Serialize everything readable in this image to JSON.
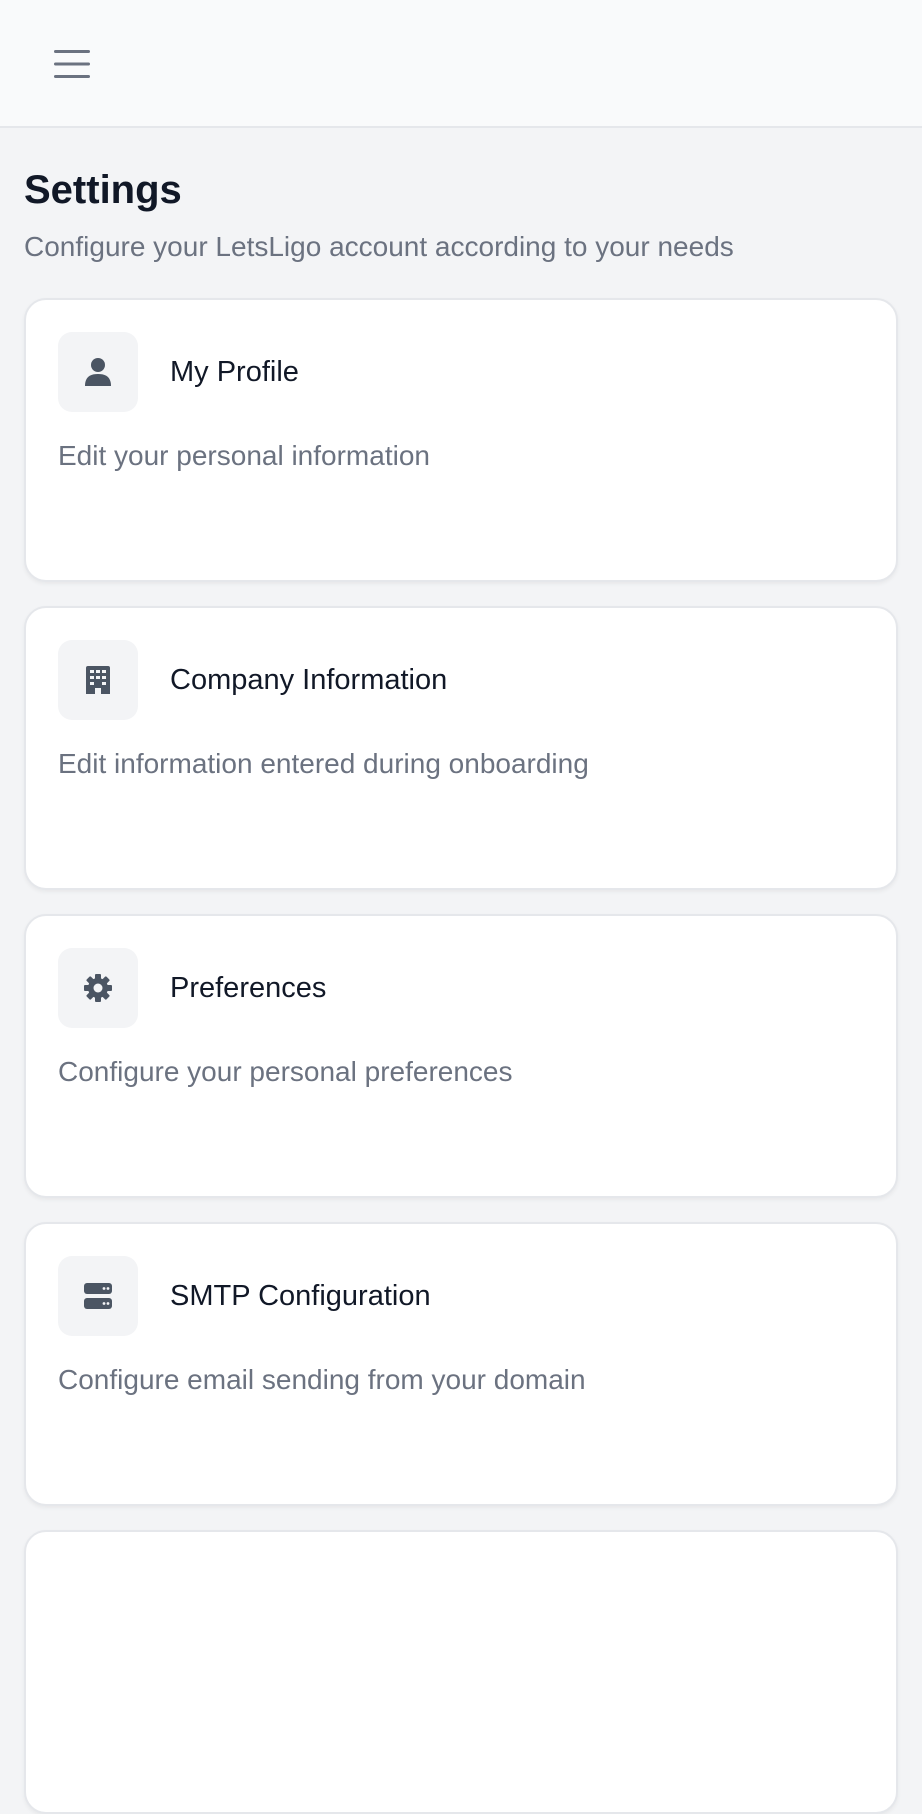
{
  "header": {
    "menu_icon": "hamburger-menu-icon"
  },
  "page": {
    "title": "Settings",
    "subtitle": "Configure your LetsLigo account according to your needs"
  },
  "cards": [
    {
      "icon": "user-icon",
      "title": "My Profile",
      "description": "Edit your personal information"
    },
    {
      "icon": "building-icon",
      "title": "Company Information",
      "description": "Edit information entered during onboarding"
    },
    {
      "icon": "gear-icon",
      "title": "Preferences",
      "description": "Configure your personal preferences"
    },
    {
      "icon": "server-icon",
      "title": "SMTP Configuration",
      "description": "Configure email sending from your domain"
    }
  ],
  "colors": {
    "background": "#f3f4f6",
    "header_background": "#f9fafb",
    "card_background": "#ffffff",
    "title_text": "#111827",
    "muted_text": "#6b7280",
    "icon": "#4b5563"
  }
}
